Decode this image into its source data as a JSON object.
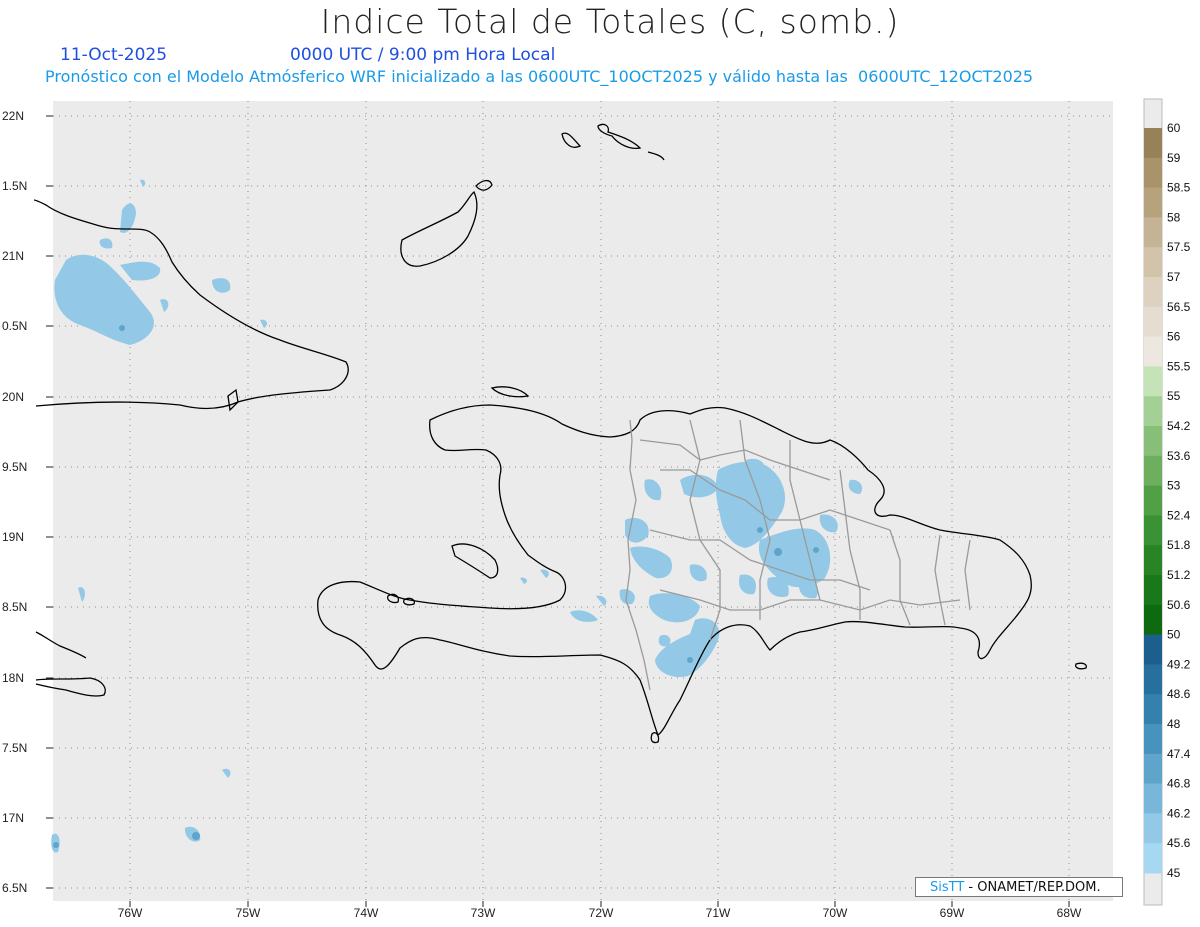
{
  "header": {
    "title": "Indice Total de Totales (C, somb.)",
    "date": "11-Oct-2025",
    "time": "0000 UTC / 9:00 pm Hora Local",
    "subtitle": "Pronóstico con el Modelo Atmósferico WRF inicializado a las 0600UTC_10OCT2025 y válido hasta las  0600UTC_12OCT2025"
  },
  "map": {
    "lat_labels": [
      "22N",
      "1.5N",
      "21N",
      "0.5N",
      "20N",
      "9.5N",
      "19N",
      "8.5N",
      "18N",
      "7.5N",
      "17N",
      "6.5N"
    ],
    "lon_labels": [
      "76W",
      "75W",
      "74W",
      "73W",
      "72W",
      "71W",
      "70W",
      "69W",
      "68W"
    ],
    "background_color": "#ebebeb",
    "coast_color": "#000000",
    "province_color": "#9a9a9a"
  },
  "colorbar": {
    "labels": [
      "60",
      "59",
      "58.5",
      "58",
      "57.5",
      "57",
      "56.5",
      "56",
      "55.5",
      "55",
      "54.2",
      "53.6",
      "53",
      "52.4",
      "51.8",
      "51.2",
      "50.6",
      "50",
      "49.2",
      "48.6",
      "48",
      "47.4",
      "46.8",
      "46.2",
      "45.6",
      "45"
    ],
    "colors": [
      "#968159",
      "#a8936b",
      "#b6a37e",
      "#c4b394",
      "#d2c4ab",
      "#ddd2bf",
      "#e5ddd0",
      "#ede8df",
      "#c4e4b7",
      "#a3d094",
      "#87bf78",
      "#6daf5f",
      "#52a046",
      "#3b9135",
      "#288424",
      "#19781a",
      "#0d6a10",
      "#1c5f8c",
      "#276f9c",
      "#3381ac",
      "#4793bd",
      "#5ea4cb",
      "#78b7d9",
      "#93c9e6",
      "#a7d8f2"
    ],
    "bottom_color": "#ebebeb"
  },
  "credit": {
    "sis": "SisTT",
    "org": " - ONAMET/REP.DOM."
  }
}
